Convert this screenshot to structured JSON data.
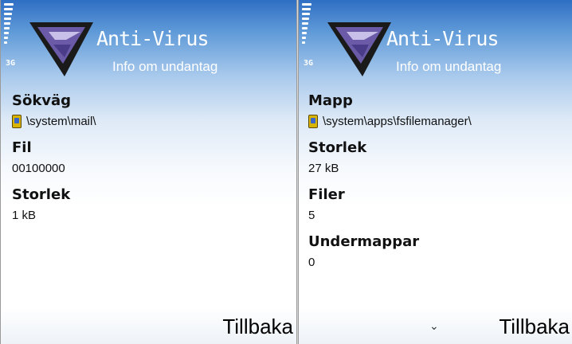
{
  "left_screen": {
    "network": "3G",
    "app_title": "Anti-Virus",
    "subtitle": "Info om undantag",
    "fields": [
      {
        "label": "Sökväg",
        "value": "\\system\\mail\\",
        "icon": "memory-icon"
      },
      {
        "label": "Fil",
        "value": "00100000"
      },
      {
        "label": "Storlek",
        "value": "1 kB"
      }
    ],
    "softkey": "Tillbaka"
  },
  "right_screen": {
    "network": "3G",
    "app_title": "Anti-Virus",
    "subtitle": "Info om undantag",
    "fields": [
      {
        "label": "Mapp",
        "value": "\\system\\apps\\fsfilemanager\\",
        "icon": "memory-icon"
      },
      {
        "label": "Storlek",
        "value": "27 kB"
      },
      {
        "label": "Filer",
        "value": "5"
      },
      {
        "label": "Undermappar",
        "value": "0"
      }
    ],
    "scroll_indicator": "⌄",
    "softkey": "Tillbaka"
  },
  "colors": {
    "header_blue": "#2f6fc4",
    "text": "#111111",
    "logo_purple": "#6a5aa8"
  }
}
